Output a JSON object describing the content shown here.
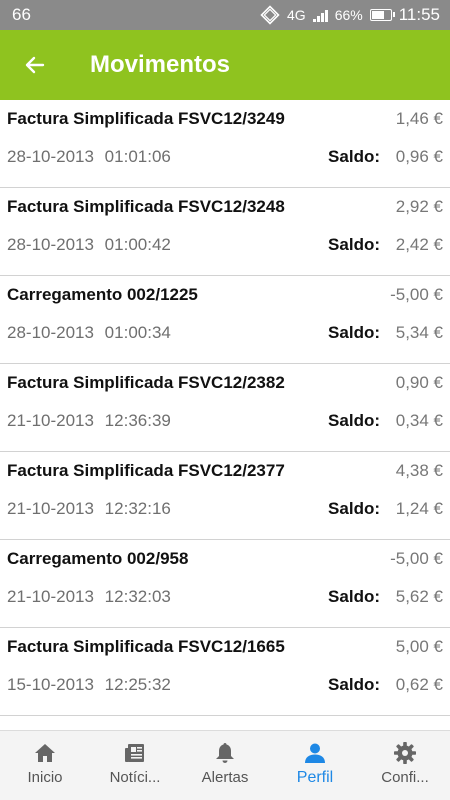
{
  "status_bar": {
    "left": "66",
    "network": "4G",
    "battery": "66%",
    "time": "11:55"
  },
  "app_bar": {
    "title": "Movimentos"
  },
  "transactions": [
    {
      "description": "Factura Simplificada FSVC12/3249",
      "amount": "1,46 €",
      "date": "28-10-2013 01:01:06",
      "saldo_label": "Saldo:",
      "saldo": "0,96 €"
    },
    {
      "description": "Factura Simplificada FSVC12/3248",
      "amount": "2,92 €",
      "date": "28-10-2013 01:00:42",
      "saldo_label": "Saldo:",
      "saldo": "2,42 €"
    },
    {
      "description": "Carregamento 002/1225",
      "amount": "-5,00 €",
      "date": "28-10-2013 01:00:34",
      "saldo_label": "Saldo:",
      "saldo": "5,34 €"
    },
    {
      "description": "Factura Simplificada FSVC12/2382",
      "amount": "0,90 €",
      "date": "21-10-2013 12:36:39",
      "saldo_label": "Saldo:",
      "saldo": "0,34 €"
    },
    {
      "description": "Factura Simplificada FSVC12/2377",
      "amount": "4,38 €",
      "date": "21-10-2013 12:32:16",
      "saldo_label": "Saldo:",
      "saldo": "1,24 €"
    },
    {
      "description": "Carregamento 002/958",
      "amount": "-5,00 €",
      "date": "21-10-2013 12:32:03",
      "saldo_label": "Saldo:",
      "saldo": "5,62 €"
    },
    {
      "description": "Factura Simplificada FSVC12/1665",
      "amount": "5,00 €",
      "date": "15-10-2013 12:25:32",
      "saldo_label": "Saldo:",
      "saldo": "0,62 €"
    }
  ],
  "bottom_nav": [
    {
      "label": "Inicio",
      "icon": "home-icon"
    },
    {
      "label": "Notíci...",
      "icon": "newspaper-icon"
    },
    {
      "label": "Alertas",
      "icon": "bell-icon"
    },
    {
      "label": "Perfil",
      "icon": "person-icon",
      "active": true
    },
    {
      "label": "Confi...",
      "icon": "gear-icon"
    }
  ],
  "colors": {
    "app_bar": "#8fc31f",
    "active_nav": "#1e88e5",
    "status_bar": "#8a8a8a"
  }
}
